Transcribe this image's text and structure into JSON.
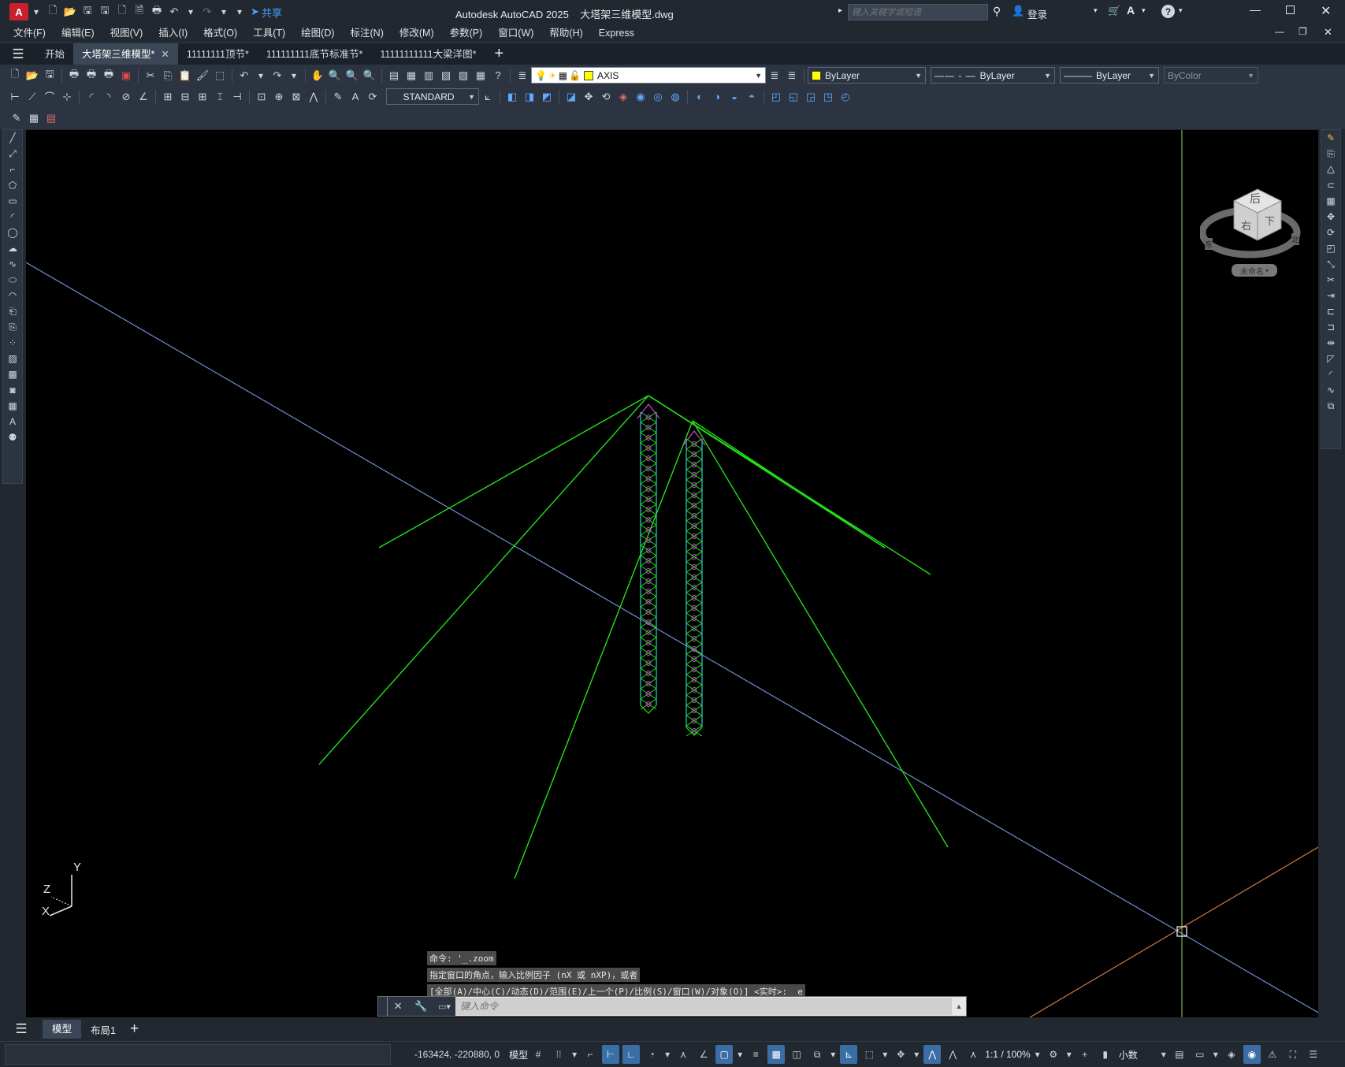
{
  "titlebar": {
    "app_icon": "A",
    "share_label": "共享",
    "title": "Autodesk AutoCAD 2025    大塔架三维模型.dwg",
    "search_placeholder": "键入关键字或短语",
    "login_label": "登录"
  },
  "menu": [
    "文件(F)",
    "编辑(E)",
    "视图(V)",
    "插入(I)",
    "格式(O)",
    "工具(T)",
    "绘图(D)",
    "标注(N)",
    "修改(M)",
    "参数(P)",
    "窗口(W)",
    "帮助(H)",
    "Express"
  ],
  "tabs": [
    {
      "label": "开始",
      "active": false,
      "closable": false
    },
    {
      "label": "大塔架三维模型*",
      "active": true,
      "closable": true
    },
    {
      "label": "11111111顶节*",
      "active": false,
      "closable": false
    },
    {
      "label": "111111111底节标准节*",
      "active": false,
      "closable": false
    },
    {
      "label": "11111111111大梁洋图*",
      "active": false,
      "closable": false
    }
  ],
  "properties": {
    "layer": "AXIS",
    "layer_color": "#ffff00",
    "color": "ByLayer",
    "linetype": "ByLayer",
    "lineweight": "ByLayer",
    "plotstyle": "ByColor",
    "dimstyle": "STANDARD"
  },
  "viewcube": {
    "faces": [
      "后",
      "下",
      "右"
    ],
    "compass": [
      "东",
      "北"
    ],
    "ucs_menu": "未命名"
  },
  "ucs_icon": {
    "x": "X",
    "y": "Y",
    "z": "Z"
  },
  "command": {
    "history": [
      "命令: '_.zoom",
      "指定窗口的角点，输入比例因子 (nX 或 nXP)，或者",
      "[全部(A)/中心(C)/动态(D)/范围(E)/上一个(P)/比例(S)/窗口(W)/对象(O)] <实时>: _e"
    ],
    "placeholder": "键入命令"
  },
  "layout_tabs": [
    "模型",
    "布局1"
  ],
  "status": {
    "coords": "-163424, -220880, 0",
    "space": "模型",
    "scale": "1:1 / 100%",
    "units": "小数"
  },
  "colors": {
    "truss_cable": "#22e01a",
    "axis_blue": "#6f8fd0",
    "axis_orange": "#d07a45",
    "axis_green": "#8fd36a",
    "truss_cyan": "#2ad0d0",
    "truss_magenta": "#d040d0"
  }
}
